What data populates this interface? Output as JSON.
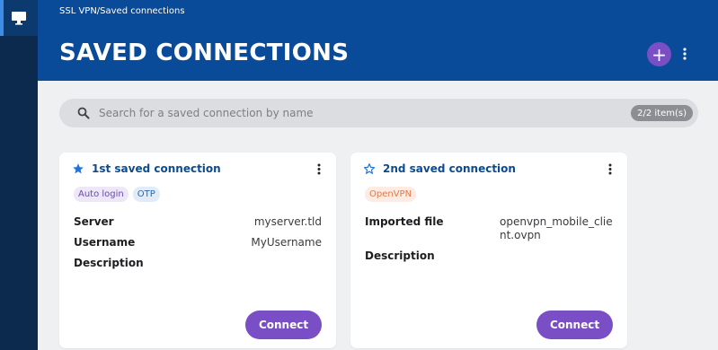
{
  "breadcrumb": "SSL VPN/Saved connections",
  "page_title": "SAVED CONNECTIONS",
  "add_button_label": "+",
  "search": {
    "placeholder": "Search for a saved connection by name",
    "count": "2/2 item(s)"
  },
  "colors": {
    "header": "#094b98",
    "sidebar": "#0c2a4e",
    "accent": "#7a4fc6",
    "title_blue": "#0d4b8f"
  },
  "connections": [
    {
      "title": "1st saved connection",
      "favorite": true,
      "tags": [
        "Auto login",
        "OTP"
      ],
      "fields": [
        {
          "label": "Server",
          "value": "myserver.tld"
        },
        {
          "label": "Username",
          "value": "MyUsername"
        },
        {
          "label": "Description",
          "value": ""
        }
      ],
      "button": "Connect"
    },
    {
      "title": "2nd saved connection",
      "favorite": false,
      "tags": [
        "OpenVPN"
      ],
      "fields": [
        {
          "label": "Imported file",
          "value": "openvpn_mobile_client.ovpn"
        },
        {
          "label": "Description",
          "value": ""
        }
      ],
      "button": "Connect"
    }
  ]
}
